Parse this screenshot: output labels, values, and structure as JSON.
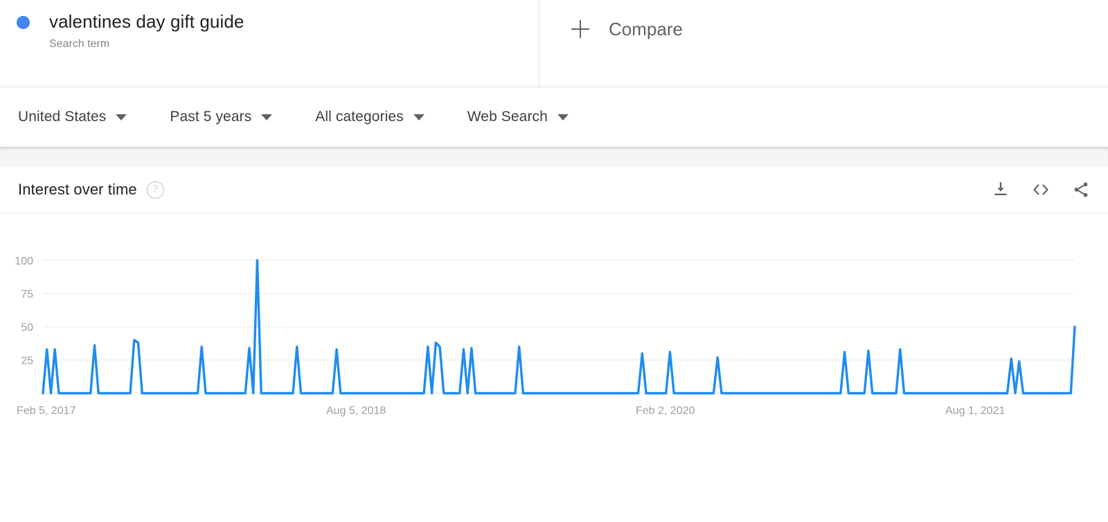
{
  "term": {
    "title": "valentines day gift guide",
    "subtitle": "Search term",
    "dot_color": "#4285f4"
  },
  "compare": {
    "label": "Compare",
    "icon": "plus-icon"
  },
  "filters": [
    {
      "label": "United States",
      "icon": "chevron-down-icon"
    },
    {
      "label": "Past 5 years",
      "icon": "chevron-down-icon"
    },
    {
      "label": "All categories",
      "icon": "chevron-down-icon"
    },
    {
      "label": "Web Search",
      "icon": "chevron-down-icon"
    }
  ],
  "card": {
    "title": "Interest over time",
    "help_icon": "help-circle-icon",
    "help_glyph": "?",
    "actions": [
      {
        "name": "download-icon"
      },
      {
        "name": "embed-code-icon"
      },
      {
        "name": "share-icon"
      }
    ]
  },
  "chart_data": {
    "type": "line",
    "title": "Interest over time",
    "xlabel": "",
    "ylabel": "",
    "ylim": [
      0,
      100
    ],
    "yticks": [
      25,
      50,
      75,
      100
    ],
    "grid": true,
    "legend_position": "top-left",
    "line_color": "#1f8cef",
    "series": [
      {
        "name": "valentines day gift guide",
        "x_tick_labels": [
          "Feb 5, 2017",
          "Aug 5, 2018",
          "Feb 2, 2020",
          "Aug 1, 2021"
        ],
        "x_tick_positions": [
          0,
          78,
          156,
          234
        ],
        "n_points": 261,
        "points": [
          {
            "i": 0,
            "v": 0
          },
          {
            "i": 1,
            "v": 33
          },
          {
            "i": 2,
            "v": 0
          },
          {
            "i": 3,
            "v": 33
          },
          {
            "i": 4,
            "v": 0
          },
          {
            "i": 12,
            "v": 0
          },
          {
            "i": 13,
            "v": 36
          },
          {
            "i": 14,
            "v": 0
          },
          {
            "i": 22,
            "v": 0
          },
          {
            "i": 23,
            "v": 40
          },
          {
            "i": 24,
            "v": 38
          },
          {
            "i": 25,
            "v": 0
          },
          {
            "i": 39,
            "v": 0
          },
          {
            "i": 40,
            "v": 35
          },
          {
            "i": 41,
            "v": 0
          },
          {
            "i": 51,
            "v": 0
          },
          {
            "i": 52,
            "v": 34
          },
          {
            "i": 53,
            "v": 0
          },
          {
            "i": 54,
            "v": 100
          },
          {
            "i": 55,
            "v": 0
          },
          {
            "i": 63,
            "v": 0
          },
          {
            "i": 64,
            "v": 35
          },
          {
            "i": 65,
            "v": 0
          },
          {
            "i": 73,
            "v": 0
          },
          {
            "i": 74,
            "v": 33
          },
          {
            "i": 75,
            "v": 0
          },
          {
            "i": 96,
            "v": 0
          },
          {
            "i": 97,
            "v": 35
          },
          {
            "i": 98,
            "v": 0
          },
          {
            "i": 99,
            "v": 38
          },
          {
            "i": 100,
            "v": 35
          },
          {
            "i": 101,
            "v": 0
          },
          {
            "i": 105,
            "v": 0
          },
          {
            "i": 106,
            "v": 33
          },
          {
            "i": 107,
            "v": 0
          },
          {
            "i": 108,
            "v": 34
          },
          {
            "i": 109,
            "v": 0
          },
          {
            "i": 119,
            "v": 0
          },
          {
            "i": 120,
            "v": 35
          },
          {
            "i": 121,
            "v": 0
          },
          {
            "i": 150,
            "v": 0
          },
          {
            "i": 151,
            "v": 30
          },
          {
            "i": 152,
            "v": 0
          },
          {
            "i": 157,
            "v": 0
          },
          {
            "i": 158,
            "v": 31
          },
          {
            "i": 159,
            "v": 0
          },
          {
            "i": 169,
            "v": 0
          },
          {
            "i": 170,
            "v": 27
          },
          {
            "i": 171,
            "v": 0
          },
          {
            "i": 201,
            "v": 0
          },
          {
            "i": 202,
            "v": 31
          },
          {
            "i": 203,
            "v": 0
          },
          {
            "i": 207,
            "v": 0
          },
          {
            "i": 208,
            "v": 32
          },
          {
            "i": 209,
            "v": 0
          },
          {
            "i": 215,
            "v": 0
          },
          {
            "i": 216,
            "v": 33
          },
          {
            "i": 217,
            "v": 0
          },
          {
            "i": 243,
            "v": 0
          },
          {
            "i": 244,
            "v": 26
          },
          {
            "i": 245,
            "v": 0
          },
          {
            "i": 246,
            "v": 24
          },
          {
            "i": 247,
            "v": 0
          },
          {
            "i": 259,
            "v": 0
          },
          {
            "i": 260,
            "v": 50
          }
        ]
      }
    ]
  }
}
